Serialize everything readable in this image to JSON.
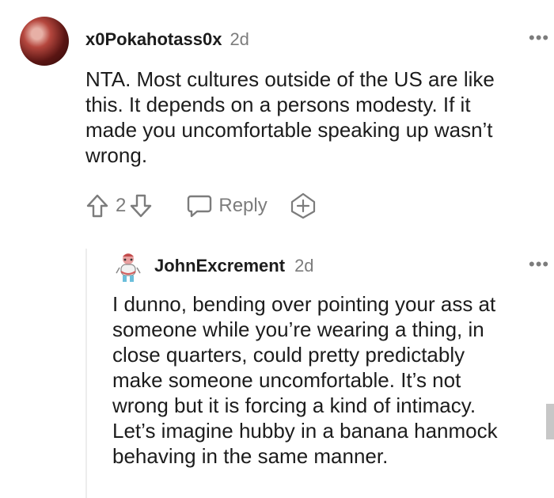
{
  "comments": [
    {
      "username": "x0Pokahotass0x",
      "age": "2d",
      "more": "•••",
      "body": [
        "NTA. Most cultures outside of the US are like",
        "this. It depends on a persons modesty. If it",
        "made you uncomfortable speaking up wasn’t",
        "wrong."
      ],
      "vote_count": "2",
      "reply_label": "Reply"
    },
    {
      "username": "JohnExcrement",
      "age": "2d",
      "more": "•••",
      "body": [
        "I dunno, bending over pointing your ass at",
        "someone while you’re wearing a thing, in",
        "close quarters, could pretty predictably",
        "make someone uncomfortable. It’s not",
        "wrong but it is forcing a kind of intimacy.",
        "Let’s imagine hubby in a banana hanmock",
        "behaving in the same manner."
      ]
    }
  ],
  "icons": [
    "upvote-icon",
    "downvote-icon",
    "reply-icon",
    "award-icon",
    "more-icon"
  ],
  "colors": {
    "text": "#1c1c1c",
    "muted": "#7c7c7c",
    "thread_line": "#ededed"
  }
}
